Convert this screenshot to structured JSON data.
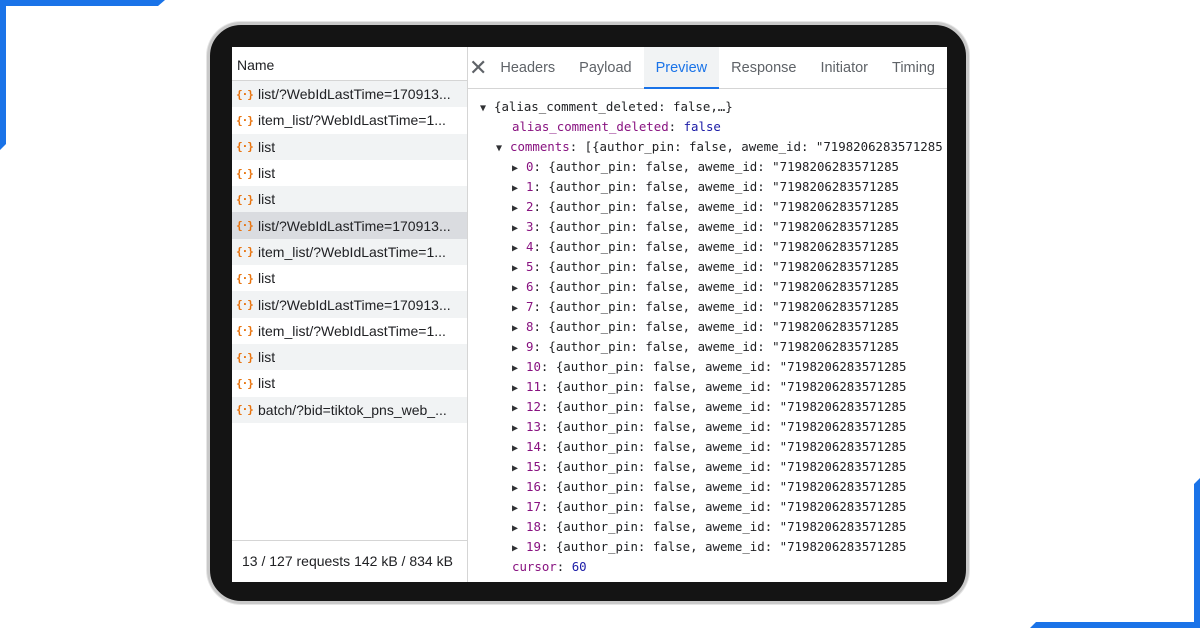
{
  "colors": {
    "accent": "#1a73e8",
    "corner": "#1a73e8",
    "icon": "#e8710a",
    "key": "#881280",
    "value": "#1a1aa6"
  },
  "network": {
    "header": "Name",
    "requests": [
      {
        "icon": "{·}",
        "name": "list/?WebIdLastTime=170913..."
      },
      {
        "icon": "{·}",
        "name": "item_list/?WebIdLastTime=1..."
      },
      {
        "icon": "{·}",
        "name": "list"
      },
      {
        "icon": "{·}",
        "name": "list"
      },
      {
        "icon": "{·}",
        "name": "list"
      },
      {
        "icon": "{·}",
        "name": "list/?WebIdLastTime=170913..."
      },
      {
        "icon": "{·}",
        "name": "item_list/?WebIdLastTime=1..."
      },
      {
        "icon": "{·}",
        "name": "list"
      },
      {
        "icon": "{·}",
        "name": "list/?WebIdLastTime=170913..."
      },
      {
        "icon": "{·}",
        "name": "item_list/?WebIdLastTime=1..."
      },
      {
        "icon": "{·}",
        "name": "list"
      },
      {
        "icon": "{·}",
        "name": "list"
      },
      {
        "icon": "{·}",
        "name": "batch/?bid=tiktok_pns_web_..."
      }
    ],
    "status": "13 / 127 requests   142 kB / 834 kB"
  },
  "tabs": [
    {
      "label": "Headers"
    },
    {
      "label": "Payload"
    },
    {
      "label": "Preview"
    },
    {
      "label": "Response"
    },
    {
      "label": "Initiator"
    },
    {
      "label": "Timing"
    }
  ],
  "preview": {
    "root_summary": "{alias_comment_deleted: false,…}",
    "alias_key": "alias_comment_deleted",
    "alias_value": "false",
    "comments_key": "comments",
    "comments_summary": "[{author_pin: false, aweme_id: \"7198206283571285",
    "comment_items": [
      {
        "index": "0",
        "summary": "{author_pin: false, aweme_id: \"7198206283571285"
      },
      {
        "index": "1",
        "summary": "{author_pin: false, aweme_id: \"7198206283571285"
      },
      {
        "index": "2",
        "summary": "{author_pin: false, aweme_id: \"7198206283571285"
      },
      {
        "index": "3",
        "summary": "{author_pin: false, aweme_id: \"7198206283571285"
      },
      {
        "index": "4",
        "summary": "{author_pin: false, aweme_id: \"7198206283571285"
      },
      {
        "index": "5",
        "summary": "{author_pin: false, aweme_id: \"7198206283571285"
      },
      {
        "index": "6",
        "summary": "{author_pin: false, aweme_id: \"7198206283571285"
      },
      {
        "index": "7",
        "summary": "{author_pin: false, aweme_id: \"7198206283571285"
      },
      {
        "index": "8",
        "summary": "{author_pin: false, aweme_id: \"7198206283571285"
      },
      {
        "index": "9",
        "summary": "{author_pin: false, aweme_id: \"7198206283571285"
      },
      {
        "index": "10",
        "summary": "{author_pin: false, aweme_id: \"7198206283571285"
      },
      {
        "index": "11",
        "summary": "{author_pin: false, aweme_id: \"7198206283571285"
      },
      {
        "index": "12",
        "summary": "{author_pin: false, aweme_id: \"7198206283571285"
      },
      {
        "index": "13",
        "summary": "{author_pin: false, aweme_id: \"7198206283571285"
      },
      {
        "index": "14",
        "summary": "{author_pin: false, aweme_id: \"7198206283571285"
      },
      {
        "index": "15",
        "summary": "{author_pin: false, aweme_id: \"7198206283571285"
      },
      {
        "index": "16",
        "summary": "{author_pin: false, aweme_id: \"7198206283571285"
      },
      {
        "index": "17",
        "summary": "{author_pin: false, aweme_id: \"7198206283571285"
      },
      {
        "index": "18",
        "summary": "{author_pin: false, aweme_id: \"7198206283571285"
      },
      {
        "index": "19",
        "summary": "{author_pin: false, aweme_id: \"7198206283571285"
      }
    ],
    "cursor_key": "cursor",
    "cursor_value": "60"
  }
}
